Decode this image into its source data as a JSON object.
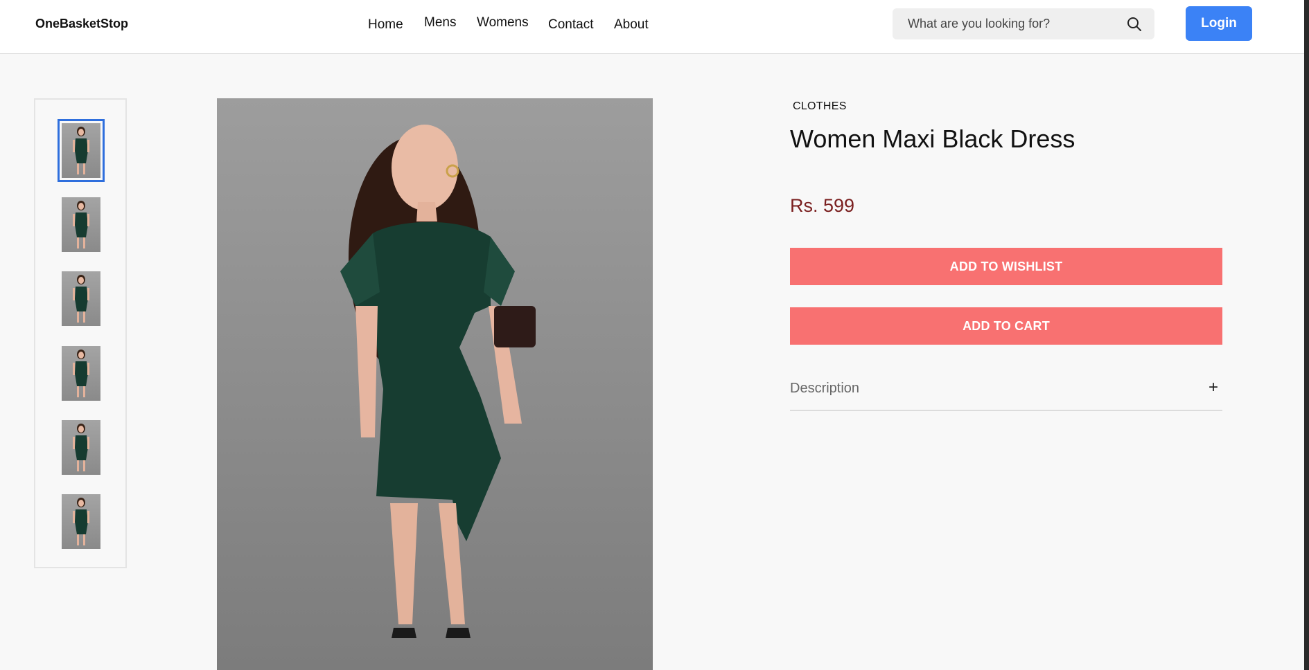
{
  "header": {
    "brand": "OneBasketStop",
    "nav": [
      {
        "label": "Home"
      },
      {
        "label": "Mens"
      },
      {
        "label": "Womens"
      },
      {
        "label": "Contact"
      },
      {
        "label": "About"
      }
    ],
    "search": {
      "placeholder": "What are you looking for?",
      "icon": "search-icon"
    },
    "login_label": "Login",
    "colors": {
      "login_bg": "#3b82f6"
    }
  },
  "gallery": {
    "thumbnail_count": 6,
    "selected_index": 0,
    "main_image_alt": "Woman wearing a dark green ruffled dress"
  },
  "product": {
    "category": "CLOTHES",
    "title": "Women Maxi Black Dress",
    "price": "Rs. 599",
    "wishlist_label": "ADD TO WISHLIST",
    "cart_label": "ADD TO CART",
    "description_label": "Description",
    "description_icon": "plus-icon",
    "colors": {
      "button_bg": "#f87171",
      "price": "#7a1f1f",
      "selected_thumb": "#2f6fdd"
    }
  }
}
